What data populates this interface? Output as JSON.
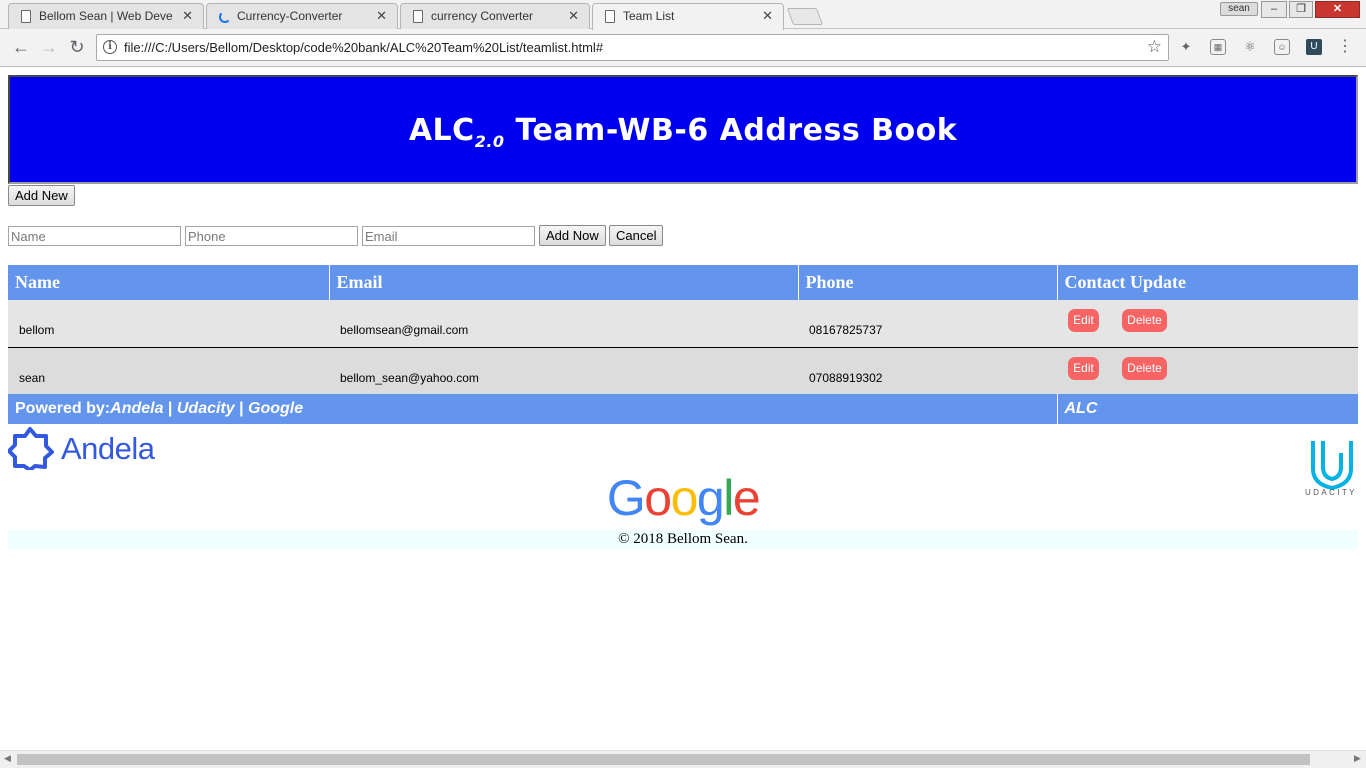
{
  "browser": {
    "tabs": [
      {
        "title": "Bellom Sean | Web Devel",
        "active": false,
        "icon": "page-icon"
      },
      {
        "title": "Currency-Converter",
        "active": false,
        "icon": "loading-icon"
      },
      {
        "title": "currency Converter",
        "active": false,
        "icon": "page-icon"
      },
      {
        "title": "Team List",
        "active": true,
        "icon": "page-icon"
      }
    ],
    "close_glyph": "✕",
    "profile_name": "sean",
    "url": "file:///C:/Users/Bellom/Desktop/code%20bank/ALC%20Team%20List/teamlist.html#"
  },
  "header": {
    "title_prefix": "ALC",
    "title_sub": "2.0",
    "title_suffix": " Team-WB-6 Address Book"
  },
  "toolbar": {
    "add_new_label": "Add New",
    "add_now_label": "Add Now",
    "cancel_label": "Cancel"
  },
  "form": {
    "name_placeholder": "Name",
    "phone_placeholder": "Phone",
    "email_placeholder": "Email",
    "name_value": "",
    "phone_value": "",
    "email_value": ""
  },
  "table": {
    "headers": [
      "Name",
      "Email",
      "Phone",
      "Contact Update"
    ],
    "rows": [
      {
        "name": "bellom",
        "email": "bellomsean@gmail.com",
        "phone": "08167825737"
      },
      {
        "name": "sean",
        "email": "bellom_sean@yahoo.com",
        "phone": "07088919302"
      }
    ],
    "edit_label": "Edit",
    "delete_label": "Delete",
    "footer_prefix": "Powered by:",
    "footer_andela": "Andela",
    "footer_sep1": " | ",
    "footer_udacity": "Udacity",
    "footer_sep2": " | ",
    "footer_google": "Google",
    "footer_right": "ALC"
  },
  "logos": {
    "andela": "Andela",
    "udacity": "UDACITY",
    "google": [
      "G",
      "o",
      "o",
      "g",
      "l",
      "e"
    ]
  },
  "copyright": "© 2018 Bellom Sean.",
  "colors": {
    "banner_bg": "#0000ee",
    "table_header": "#6495ed",
    "action_button": "#f76464",
    "andela_blue": "#3359df",
    "udacity_cyan": "#02b3e4",
    "google_blue": "#4285f4",
    "google_red": "#ea4335",
    "google_yellow": "#fbbc05",
    "google_green": "#34a853"
  }
}
